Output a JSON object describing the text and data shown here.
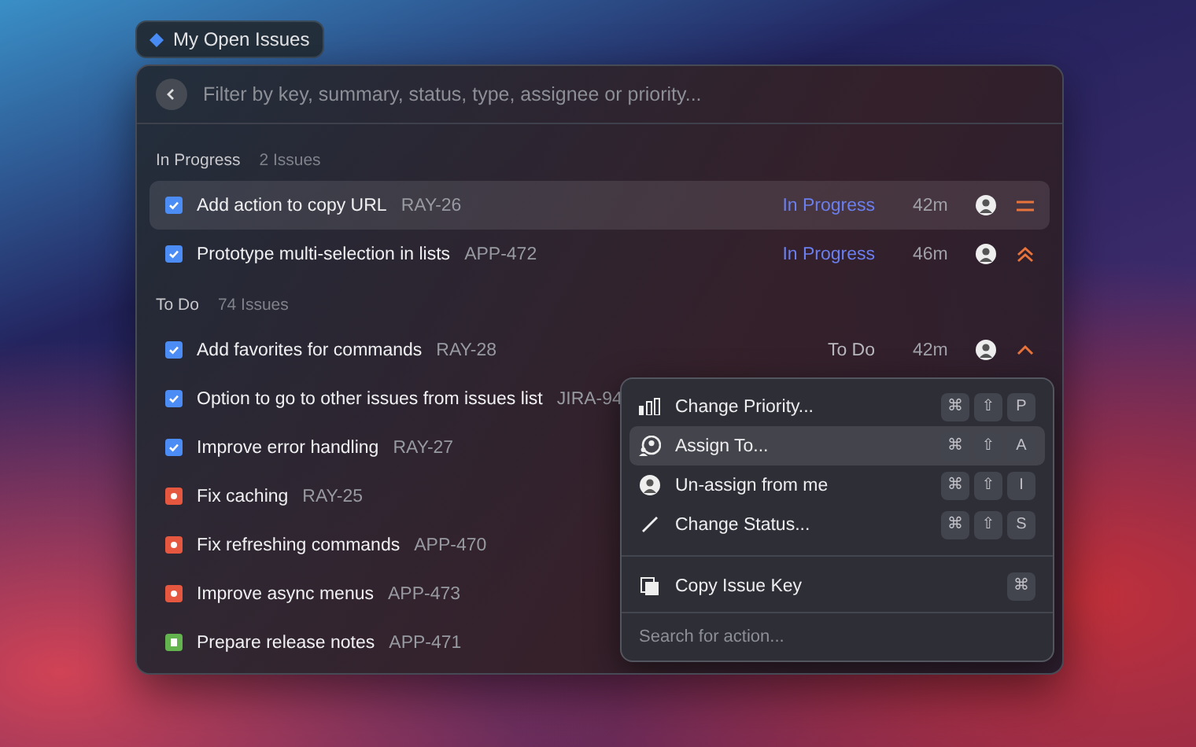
{
  "chip": {
    "title": "My Open Issues"
  },
  "search": {
    "placeholder": "Filter by key, summary, status, type, assignee or priority..."
  },
  "sections": [
    {
      "title": "In Progress",
      "count": "2 Issues",
      "issues": [
        {
          "kind": "task",
          "title": "Add action to copy URL",
          "key": "RAY-26",
          "status": {
            "text": "In Progress",
            "color": "#6b7ff0"
          },
          "age": "42m",
          "priority": {
            "kind": "medium"
          },
          "selected": true
        },
        {
          "kind": "task",
          "title": "Prototype multi-selection in lists",
          "key": "APP-472",
          "status": {
            "text": "In Progress",
            "color": "#6b7ff0"
          },
          "age": "46m",
          "priority": {
            "kind": "highest"
          },
          "selected": false
        }
      ]
    },
    {
      "title": "To Do",
      "count": "74 Issues",
      "issues": [
        {
          "kind": "task",
          "title": "Add favorites for commands",
          "key": "RAY-28",
          "status": {
            "text": "To Do",
            "color": "#b8b8be"
          },
          "age": "42m",
          "priority": {
            "kind": "high"
          },
          "selected": false
        },
        {
          "kind": "task",
          "title": "Option to go to other issues from issues list",
          "key": "JIRA-94",
          "selected": false
        },
        {
          "kind": "task",
          "title": "Improve error handling",
          "key": "RAY-27",
          "selected": false
        },
        {
          "kind": "bug",
          "title": "Fix caching",
          "key": "RAY-25",
          "selected": false
        },
        {
          "kind": "bug",
          "title": "Fix refreshing commands",
          "key": "APP-470",
          "selected": false
        },
        {
          "kind": "bug",
          "title": "Improve async menus",
          "key": "APP-473",
          "selected": false
        },
        {
          "kind": "story",
          "title": "Prepare release notes",
          "key": "APP-471",
          "selected": false
        }
      ]
    }
  ],
  "action_menu": {
    "items": [
      {
        "kind": "bars",
        "label": "Change Priority...",
        "keys": [
          "⌘",
          "⇧",
          "P"
        ],
        "selected": false
      },
      {
        "kind": "people",
        "label": "Assign To...",
        "keys": [
          "⌘",
          "⇧",
          "A"
        ],
        "selected": true
      },
      {
        "kind": "avatar",
        "label": "Un-assign from me",
        "keys": [
          "⌘",
          "⇧",
          "I"
        ],
        "selected": false
      },
      {
        "kind": "slash",
        "label": "Change Status...",
        "keys": [
          "⌘",
          "⇧",
          "S"
        ],
        "selected": false
      },
      {
        "kind": "copy",
        "label": "Copy Issue Key",
        "keys": [
          "⌘"
        ],
        "selected": false,
        "divider_before": true
      }
    ],
    "search_placeholder": "Search for action..."
  }
}
